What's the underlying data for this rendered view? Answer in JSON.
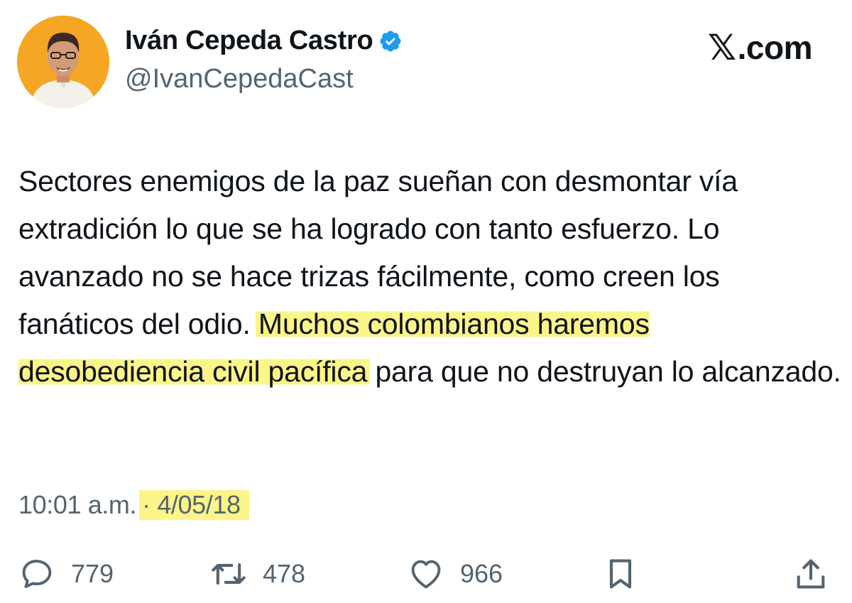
{
  "author": {
    "display_name": "Iván Cepeda Castro",
    "handle": "@IvanCepedaCast",
    "verified_icon": "verified-badge-icon",
    "avatar_bg": "#f5a623"
  },
  "brand": {
    "x_glyph": "𝕏",
    "suffix": ".com"
  },
  "tweet": {
    "text_plain": "Sectores enemigos de la paz sueñan con desmontar vía extradición lo que se ha logrado con tanto esfuerzo. Lo avanzado no se hace trizas fácilmente, como creen los fanáticos del odio. ",
    "text_highlight": "Muchos colombianos haremos desobediencia civil pacífica",
    "text_end": " para que no destruyan lo alcanzado."
  },
  "meta": {
    "time": "10:01 a.m.",
    "separator": "·",
    "date": "4/05/18"
  },
  "actions": {
    "reply_count": "779",
    "retweet_count": "478",
    "like_count": "966"
  },
  "colors": {
    "highlight": "#fbf589",
    "text": "#0f1419",
    "muted": "#536471",
    "verified": "#1d9bf0"
  }
}
